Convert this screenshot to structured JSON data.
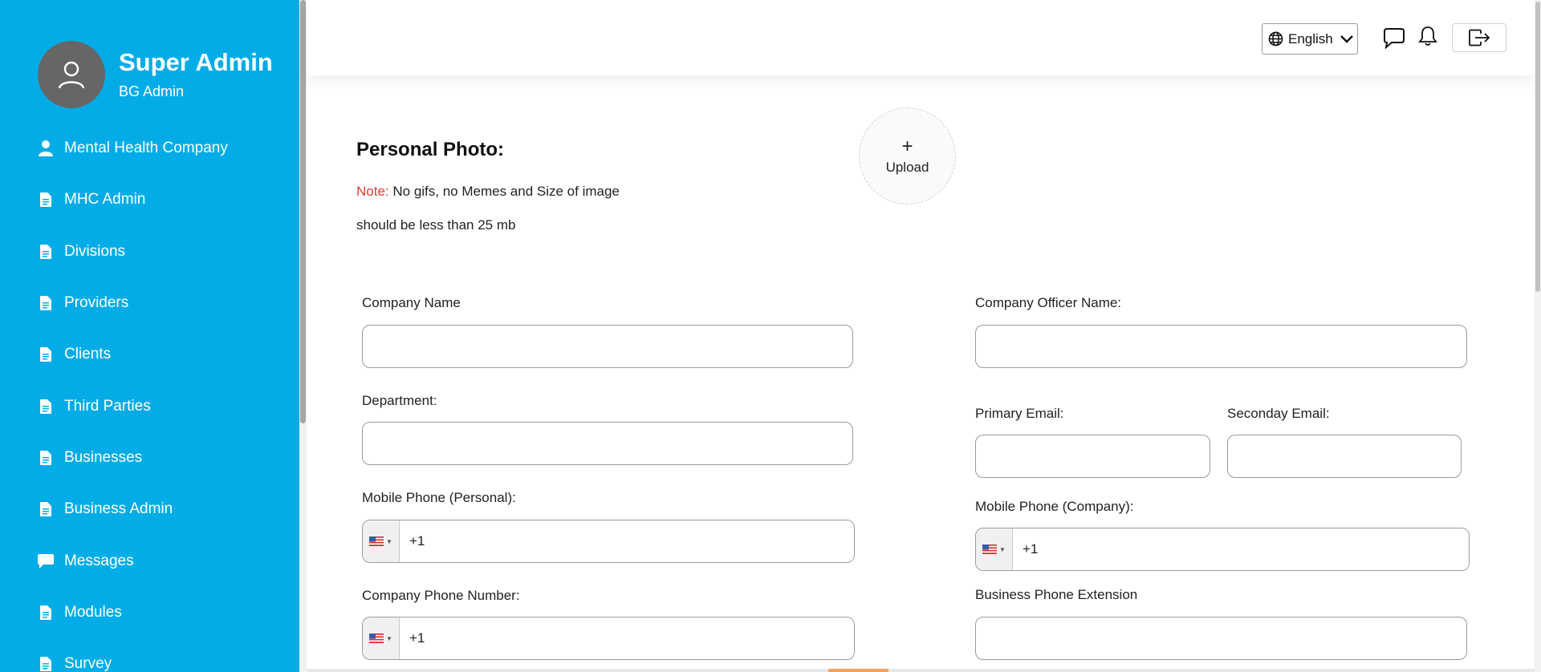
{
  "sidebar": {
    "profile": {
      "name": "Super Admin",
      "role": "BG Admin"
    },
    "items": [
      {
        "label": "Mental Health Company",
        "icon": "user-icon"
      },
      {
        "label": "MHC Admin",
        "icon": "document-icon"
      },
      {
        "label": "Divisions",
        "icon": "document-icon"
      },
      {
        "label": "Providers",
        "icon": "document-icon"
      },
      {
        "label": "Clients",
        "icon": "document-icon"
      },
      {
        "label": "Third Parties",
        "icon": "document-icon"
      },
      {
        "label": "Businesses",
        "icon": "document-icon"
      },
      {
        "label": "Business Admin",
        "icon": "document-icon"
      },
      {
        "label": "Messages",
        "icon": "chat-bubble-icon"
      },
      {
        "label": "Modules",
        "icon": "document-icon"
      },
      {
        "label": "Survey",
        "icon": "document-icon"
      }
    ]
  },
  "header": {
    "language": "English"
  },
  "form": {
    "photo": {
      "title": "Personal Photo:",
      "note_label": "Note:",
      "note_line1": " No gifs, no Memes and Size of image",
      "note_line2": "should be less than 25 mb",
      "upload_plus": "+",
      "upload_label": "Upload"
    },
    "fields": {
      "company_name": {
        "label": "Company Name",
        "value": ""
      },
      "company_officer_name": {
        "label": "Company Officer Name:",
        "value": ""
      },
      "department": {
        "label": "Department:",
        "value": ""
      },
      "primary_email": {
        "label": "Primary Email:",
        "value": ""
      },
      "secondary_email": {
        "label": "Seconday Email:",
        "value": ""
      },
      "mobile_personal": {
        "label": "Mobile Phone (Personal):",
        "value": "+1"
      },
      "mobile_company": {
        "label": "Mobile Phone (Company):",
        "value": "+1"
      },
      "company_phone": {
        "label": "Company Phone Number:",
        "value": "+1"
      },
      "business_phone_ext": {
        "label": "Business Phone Extension",
        "value": ""
      }
    }
  },
  "colors": {
    "sidebar_bg": "#03ace6",
    "note_accent": "#e53935"
  }
}
